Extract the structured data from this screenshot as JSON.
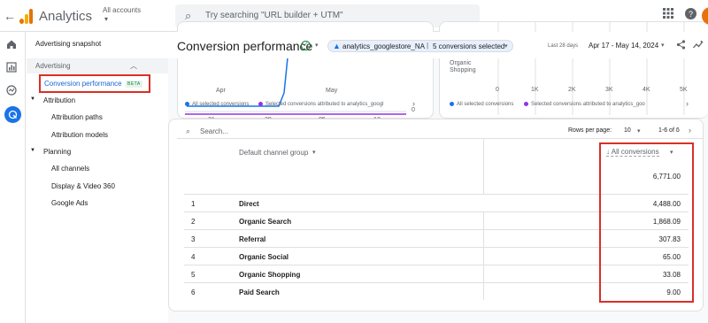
{
  "topbar": {
    "back_icon": "back-arrow-icon",
    "app_title": "Analytics",
    "account_label": "All accounts",
    "account_caret": "▾",
    "search_placeholder": "Try searching \"URL builder + UTM\"",
    "icons": [
      "apps-grid-icon",
      "help-icon",
      "avatar"
    ]
  },
  "rail": {
    "icons": [
      "home-icon",
      "reports-icon",
      "explore-icon",
      "advertising-icon"
    ]
  },
  "sidenav": {
    "advertising_snapshot": "Advertising snapshot",
    "advertising": "Advertising",
    "conversion_performance": "Conversion performance",
    "beta_badge": "BETA",
    "attribution": "Attribution",
    "attribution_paths": "Attribution paths",
    "attribution_models": "Attribution models",
    "planning": "Planning",
    "all_channels": "All channels",
    "display_video": "Display & Video 360",
    "google_ads": "Google Ads"
  },
  "header": {
    "title": "Conversion performance",
    "property_chip": "analytics_googlestore_NA",
    "conversions_chip": "5 conversions selected",
    "last_days": "Last 28 days",
    "date_range": "Apr 17 - May 14, 2024"
  },
  "left_chart": {
    "x_ticks": [
      {
        "day": "21",
        "month": "Apr"
      },
      {
        "day": "28",
        "month": ""
      },
      {
        "day": "05",
        "month": "May"
      },
      {
        "day": "12",
        "month": ""
      }
    ],
    "zero_label": "0",
    "legend": [
      "All selected conversions",
      "Selected conversions attributed to analytics_googl"
    ]
  },
  "right_chart": {
    "category_label_1": "Organic",
    "category_label_2": "Shopping",
    "x_ticks": [
      "0",
      "1K",
      "2K",
      "3K",
      "4K",
      "5K"
    ],
    "legend": [
      "All selected conversions",
      "Selected conversions attributed to analytics_goo"
    ]
  },
  "colors": {
    "series_all": "#1a73e8",
    "series_attributed": "#9334e6",
    "highlight_box": "#d93025"
  },
  "table": {
    "search_placeholder": "Search...",
    "rows_per_page_label": "Rows per page:",
    "rows_per_page_value": "10",
    "pagination": "1-6 of 6",
    "dimension_header": "Default channel group",
    "metric_header": "All conversions",
    "total": "6,771.00",
    "rows": [
      {
        "idx": "1",
        "name": "Direct",
        "value": "4,488.00"
      },
      {
        "idx": "2",
        "name": "Organic Search",
        "value": "1,868.09"
      },
      {
        "idx": "3",
        "name": "Referral",
        "value": "307.83"
      },
      {
        "idx": "4",
        "name": "Organic Social",
        "value": "65.00"
      },
      {
        "idx": "5",
        "name": "Organic Shopping",
        "value": "33.08"
      },
      {
        "idx": "6",
        "name": "Paid Search",
        "value": "9.00"
      }
    ]
  }
}
